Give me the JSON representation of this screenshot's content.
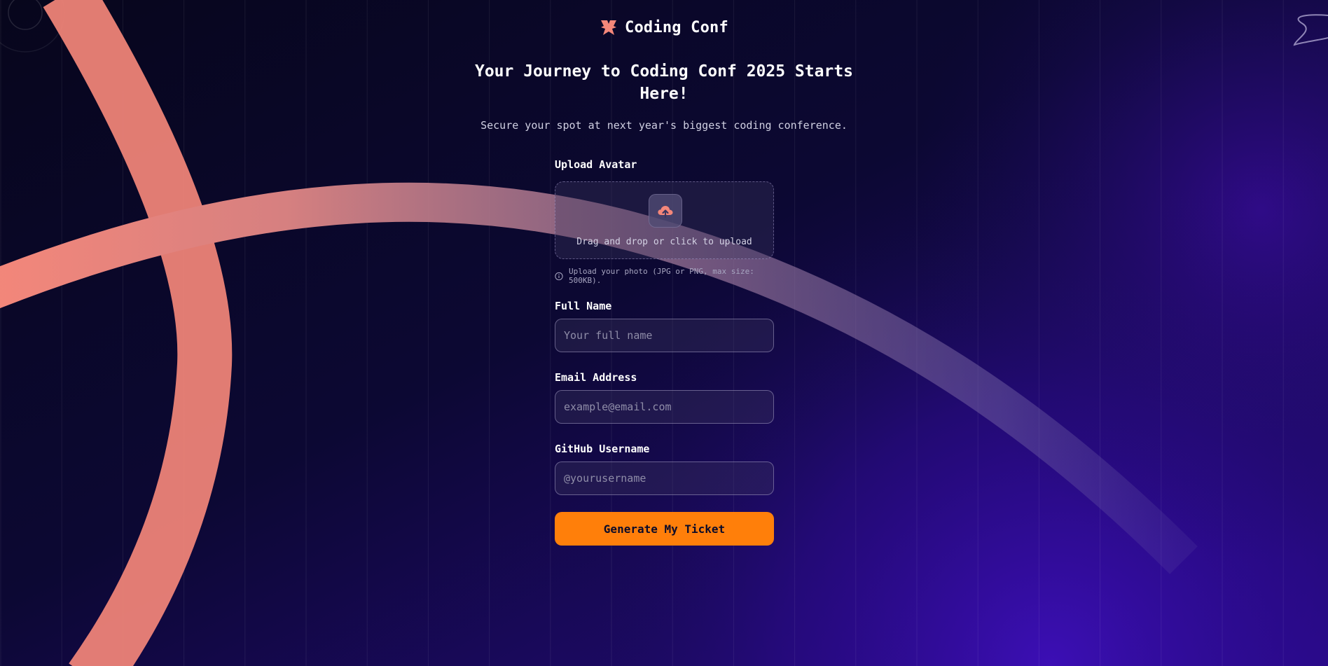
{
  "brand": {
    "name": "Coding Conf",
    "icon": "coding-conf-logo-icon"
  },
  "hero": {
    "title": "Your Journey to Coding Conf 2025 Starts Here!",
    "subtitle": "Secure your spot at next year's biggest coding conference."
  },
  "form": {
    "avatar": {
      "label": "Upload Avatar",
      "dropzone_text": "Drag and drop or click to upload",
      "hint": "Upload your photo (JPG or PNG, max size: 500KB).",
      "icon": "upload-cloud-icon",
      "hint_icon": "info-icon"
    },
    "full_name": {
      "label": "Full Name",
      "placeholder": "Your full name",
      "value": ""
    },
    "email": {
      "label": "Email Address",
      "placeholder": "example@email.com",
      "value": ""
    },
    "github": {
      "label": "GitHub Username",
      "placeholder": "@yourusername",
      "value": ""
    },
    "submit_label": "Generate My Ticket"
  },
  "colors": {
    "accent": "#ff7f0a",
    "coral": "#f4877a",
    "background": "#0a0a2a",
    "purple_glow": "#3b0aa8"
  }
}
